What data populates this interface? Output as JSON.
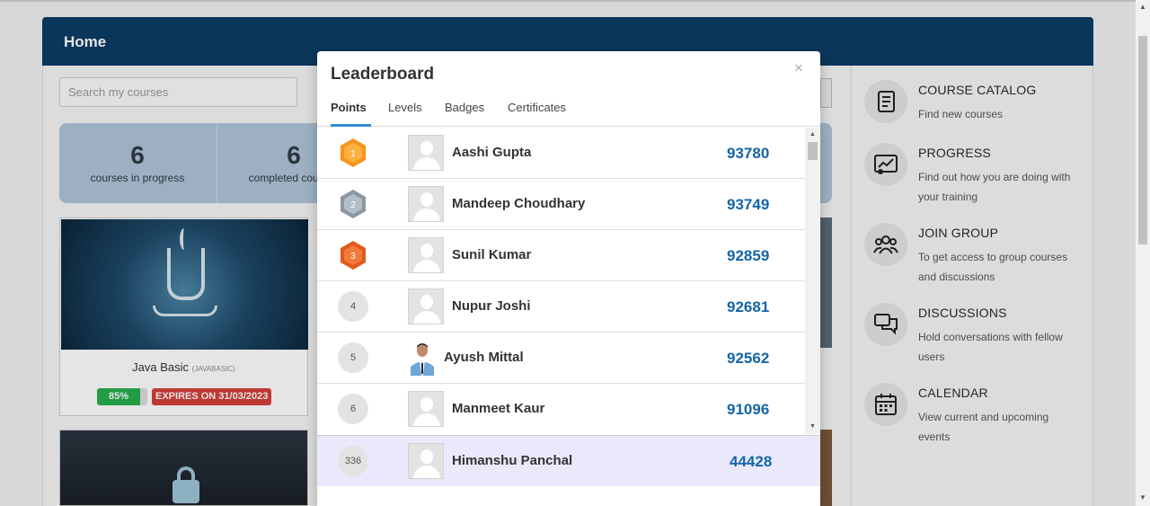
{
  "page": {
    "header_title": "Home",
    "search_placeholder": "Search my courses",
    "stats": [
      {
        "value": "6",
        "label": "courses in progress"
      },
      {
        "value": "6",
        "label": "completed courses"
      }
    ],
    "courses": [
      {
        "title": "Java Basic",
        "code": "(JAVABASIC)",
        "progress": "85%",
        "progress_value": 0.85,
        "expiry": "EXPIRES ON 31/03/2023"
      }
    ]
  },
  "sidebar": {
    "items": [
      {
        "title": "COURSE CATALOG",
        "desc": "Find new courses",
        "icon": "book-icon"
      },
      {
        "title": "PROGRESS",
        "desc": "Find out how you are doing with your training",
        "icon": "progress-chart-icon"
      },
      {
        "title": "JOIN GROUP",
        "desc": "To get access to group courses and discussions",
        "icon": "group-icon"
      },
      {
        "title": "DISCUSSIONS",
        "desc": "Hold conversations with fellow users",
        "icon": "chat-icon"
      },
      {
        "title": "CALENDAR",
        "desc": "View current and upcoming events",
        "icon": "calendar-icon"
      }
    ]
  },
  "leaderboard": {
    "title": "Leaderboard",
    "close": "×",
    "tabs": [
      "Points",
      "Levels",
      "Badges",
      "Certificates"
    ],
    "active_tab": "Points",
    "rows": [
      {
        "rank": "1",
        "name": "Aashi Gupta",
        "points": "93780",
        "medal": "gold"
      },
      {
        "rank": "2",
        "name": "Mandeep Choudhary",
        "points": "93749",
        "medal": "silver"
      },
      {
        "rank": "3",
        "name": "Sunil Kumar",
        "points": "92859",
        "medal": "bronze"
      },
      {
        "rank": "4",
        "name": "Nupur Joshi",
        "points": "92681"
      },
      {
        "rank": "5",
        "name": "Ayush Mittal",
        "points": "92562",
        "photo": true
      },
      {
        "rank": "6",
        "name": "Manmeet Kaur",
        "points": "91096"
      }
    ],
    "current_user": {
      "rank": "336",
      "name": "Himanshu Panchal",
      "points": "44428"
    }
  },
  "colors": {
    "header_bg": "#0d3d66",
    "points_text": "#1565a8",
    "tab_accent": "#2e8ece",
    "gold": "#f7941d",
    "silver": "#8c96a3",
    "bronze": "#e05a1e",
    "current_user_bg": "#e9e9fb"
  }
}
